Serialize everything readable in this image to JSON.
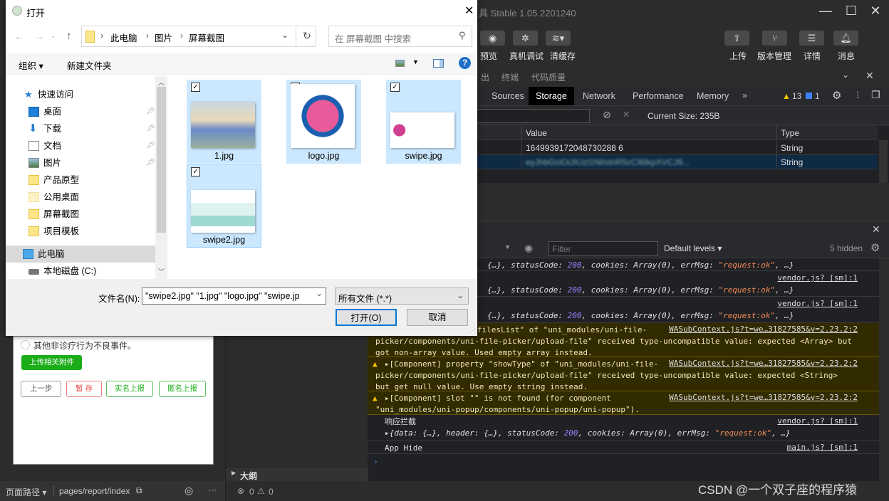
{
  "ide": {
    "title": "具 Stable 1.05.2201240",
    "toolbar_left": [
      {
        "icon": "eye-icon",
        "label": "预览"
      },
      {
        "icon": "bug-icon",
        "label": "真机调试"
      },
      {
        "icon": "layers-icon",
        "label": "清缓存"
      }
    ],
    "toolbar_right": [
      {
        "icon": "upload-icon",
        "label": "上传"
      },
      {
        "icon": "branch-icon",
        "label": "版本管理"
      },
      {
        "icon": "menu-icon",
        "label": "详情"
      },
      {
        "icon": "bell-icon",
        "label": "消息"
      }
    ],
    "panel_tabs": [
      "出",
      "终端",
      "代码质量"
    ],
    "devtools_tabs": [
      "Sources",
      "Storage",
      "Network",
      "Performance",
      "Memory"
    ],
    "active_devtools_tab": "Storage",
    "warning_count": "13",
    "info_count": "1",
    "storage": {
      "current_size": "Current Size: 235B",
      "columns": [
        "Value",
        "Type"
      ],
      "rows": [
        {
          "value": "1649939172048730288 6",
          "type": "String"
        },
        {
          "value": "eyJhbGciOiJIUzI1NiIsInR5cCI6IkpXVCJ9...",
          "type": "String"
        }
      ]
    },
    "console": {
      "filter_placeholder": "Filter",
      "levels": "Default levels",
      "hidden": "5 hidden",
      "messages": [
        {
          "kind": "log",
          "link": "",
          "lines": [
            "{…}, statusCode: |200|, cookies: Array(0), errMsg: |\"request:ok\"|, …}"
          ]
        },
        {
          "kind": "log",
          "link": "vendor.js? [sm]:1",
          "lines": [
            "{…}, statusCode: |200|, cookies: Array(0), errMsg: |\"request:ok\"|, …}"
          ]
        },
        {
          "kind": "log",
          "link": "vendor.js? [sm]:1",
          "lines": [
            "{…}, statusCode: |200|, cookies: Array(0), errMsg: |\"request:ok\"|, …}"
          ]
        },
        {
          "kind": "warn",
          "link": "WASubContext.js?t=we…31827585&v=2.23.2:2",
          "lines": [
            "y \"filesList\" of \"uni_modules/uni-file-",
            "picker/components/uni-file-picker/upload-file\" received type-uncompatible value: expected <Array> but",
            "got non-array value. Used empty array instead."
          ]
        },
        {
          "kind": "warn",
          "link": "WASubContext.js?t=we…31827585&v=2.23.2:2",
          "lines": [
            "▸[Component] property \"showType\" of \"uni_modules/uni-file-",
            "picker/components/uni-file-picker/upload-file\" received type-uncompatible value: expected <String>",
            "but get null value. Use empty string instead."
          ]
        },
        {
          "kind": "warn",
          "link": "WASubContext.js?t=we…31827585&v=2.23.2:2",
          "lines": [
            "▸[Component] slot \"\" is not found (for component",
            "\"uni_modules/uni-popup/components/uni-popup/uni-popup\")."
          ]
        },
        {
          "kind": "log",
          "link": "vendor.js? [sm]:1",
          "lines": [
            "响应拦截",
            "▸{data: {…}, header: {…}, statusCode: |200|, cookies: Array(0), errMsg: |\"request:ok\"|, …}"
          ]
        },
        {
          "kind": "log",
          "link": "main.js? [sm]:1",
          "lines": [
            "App Hide"
          ]
        }
      ],
      "prompt": "›"
    },
    "simulator": {
      "radio_label": "其他非诊疗行为不良事件。",
      "upload_button": "上传相关附件",
      "buttons": [
        "上一步",
        "暂 存",
        "实名上报",
        "匿名上报"
      ]
    },
    "footer": {
      "path_label": "页面路径",
      "path": "pages/report/index",
      "outline": "大纲",
      "errors": "0",
      "warnings": "0"
    },
    "watermark": "CSDN @一个双子座的程序猿"
  },
  "dialog": {
    "title": "打开",
    "breadcrumb": [
      "此电脑",
      "图片",
      "屏幕截图"
    ],
    "search_placeholder": "在 屏幕截图 中搜索",
    "organize": "组织",
    "new_folder": "新建文件夹",
    "nav": {
      "quick_access": "快速访问",
      "items": [
        {
          "label": "桌面",
          "icon": "desktop-icon",
          "pinned": true
        },
        {
          "label": "下载",
          "icon": "download-icon",
          "pinned": true
        },
        {
          "label": "文档",
          "icon": "document-icon",
          "pinned": true
        },
        {
          "label": "图片",
          "icon": "pictures-icon",
          "pinned": true
        },
        {
          "label": "产品原型",
          "icon": "folder-icon",
          "pinned": false
        },
        {
          "label": "公用桌面",
          "icon": "folder-icon",
          "pinned": false
        },
        {
          "label": "屏幕截图",
          "icon": "folder-icon",
          "pinned": false
        },
        {
          "label": "项目模板",
          "icon": "folder-icon",
          "pinned": false
        }
      ],
      "this_pc": "此电脑",
      "local_disk": "本地磁盘 (C:)"
    },
    "files": [
      {
        "name": "1.jpg",
        "selected": true
      },
      {
        "name": "logo.jpg",
        "selected": true
      },
      {
        "name": "swipe.jpg",
        "selected": true
      },
      {
        "name": "swipe2.jpg",
        "selected": true
      }
    ],
    "filename_label": "文件名(N):",
    "filename_value": "\"swipe2.jpg\" \"1.jpg\" \"logo.jpg\" \"swipe.jp",
    "filetype": "所有文件 (*.*)",
    "open_button": "打开(O)",
    "cancel_button": "取消"
  }
}
